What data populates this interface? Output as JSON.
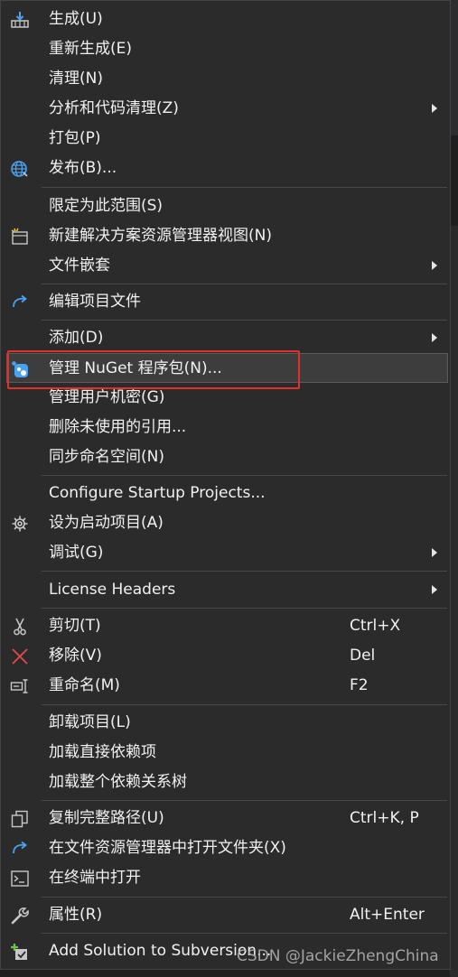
{
  "menu": {
    "items": [
      {
        "key": "build",
        "label": "生成(U)",
        "icon": "build-icon"
      },
      {
        "key": "rebuild",
        "label": "重新生成(E)"
      },
      {
        "key": "clean",
        "label": "清理(N)"
      },
      {
        "key": "analyze",
        "label": "分析和代码清理(Z)",
        "submenu": true
      },
      {
        "key": "pack",
        "label": "打包(P)"
      },
      {
        "key": "publish",
        "label": "发布(B)...",
        "icon": "globe-icon"
      },
      {
        "key": "scope",
        "label": "限定为此范围(S)"
      },
      {
        "key": "new-view",
        "label": "新建解决方案资源管理器视图(N)",
        "icon": "new-view-icon"
      },
      {
        "key": "file-nesting",
        "label": "文件嵌套",
        "submenu": true
      },
      {
        "key": "edit-project",
        "label": "编辑项目文件",
        "icon": "edit-arrow-icon"
      },
      {
        "key": "add",
        "label": "添加(D)",
        "submenu": true
      },
      {
        "key": "nuget",
        "label": "管理 NuGet 程序包(N)...",
        "icon": "nuget-icon"
      },
      {
        "key": "user-secrets",
        "label": "管理用户机密(G)"
      },
      {
        "key": "remove-unused",
        "label": "删除未使用的引用..."
      },
      {
        "key": "sync-namespaces",
        "label": "同步命名空间(N)"
      },
      {
        "key": "startup-projects",
        "label": "Configure Startup Projects..."
      },
      {
        "key": "set-startup",
        "label": "设为启动项目(A)",
        "icon": "gear-icon"
      },
      {
        "key": "debug",
        "label": "调试(G)",
        "submenu": true
      },
      {
        "key": "license-headers",
        "label": "License Headers",
        "submenu": true
      },
      {
        "key": "cut",
        "label": "剪切(T)",
        "shortcut": "Ctrl+X",
        "icon": "scissors-icon"
      },
      {
        "key": "remove",
        "label": "移除(V)",
        "shortcut": "Del",
        "icon": "remove-x-icon"
      },
      {
        "key": "rename",
        "label": "重命名(M)",
        "shortcut": "F2",
        "icon": "rename-icon"
      },
      {
        "key": "unload",
        "label": "卸载项目(L)"
      },
      {
        "key": "load-direct",
        "label": "加载直接依赖项"
      },
      {
        "key": "load-tree",
        "label": "加载整个依赖关系树"
      },
      {
        "key": "copy-path",
        "label": "复制完整路径(U)",
        "shortcut": "Ctrl+K, P",
        "icon": "copy-icon"
      },
      {
        "key": "open-folder",
        "label": "在文件资源管理器中打开文件夹(X)",
        "icon": "open-folder-arrow-icon"
      },
      {
        "key": "open-terminal",
        "label": "在终端中打开",
        "icon": "terminal-icon"
      },
      {
        "key": "properties",
        "label": "属性(R)",
        "shortcut": "Alt+Enter",
        "icon": "wrench-icon"
      },
      {
        "key": "add-svn",
        "label": "Add Solution to Subversion...",
        "icon": "svn-add-icon"
      }
    ]
  },
  "watermark": "CSDN @JackieZhengChina",
  "colors": {
    "menu_bg": "#2b2b2b",
    "hover_bg": "#3d3d3d",
    "text": "#f1f1f1",
    "separator": "#4a4a4d",
    "annotation_red": "#e0322a",
    "icon_blue": "#4aa3f0"
  }
}
